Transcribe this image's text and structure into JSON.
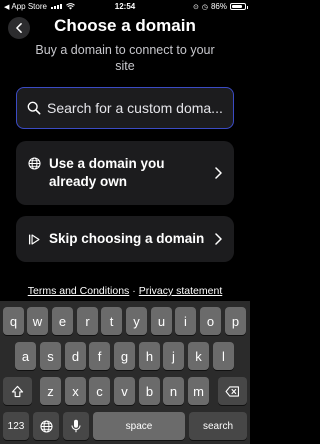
{
  "status_bar": {
    "back_app": "App Store",
    "time": "12:54",
    "battery": "86%",
    "battery_level": 0.86
  },
  "header": {
    "back_icon": "chevron-left-icon",
    "title": "Choose a domain",
    "subtitle": "Buy a domain to connect to your site"
  },
  "search": {
    "placeholder": "Search for a custom doma...",
    "icon": "search-icon"
  },
  "options": [
    {
      "label": "Use a domain you already own",
      "icon": "globe-icon"
    },
    {
      "label": "Skip choosing a domain",
      "icon": "skip-forward-icon"
    }
  ],
  "legal": {
    "terms": "Terms and Conditions",
    "separator": "·",
    "privacy": "Privacy statement"
  },
  "keyboard": {
    "row1": [
      "q",
      "w",
      "e",
      "r",
      "t",
      "y",
      "u",
      "i",
      "o",
      "p"
    ],
    "row2": [
      "a",
      "s",
      "d",
      "f",
      "g",
      "h",
      "j",
      "k",
      "l"
    ],
    "row3": [
      "z",
      "x",
      "c",
      "v",
      "b",
      "n",
      "m"
    ],
    "numbers_key": "123",
    "space_key": "space",
    "search_key": "search"
  },
  "colors": {
    "background": "#000000",
    "card": "#1c1c1e",
    "accent_border": "#3b4bc4",
    "key": "#6b6b6b",
    "key_dark": "#474747"
  }
}
